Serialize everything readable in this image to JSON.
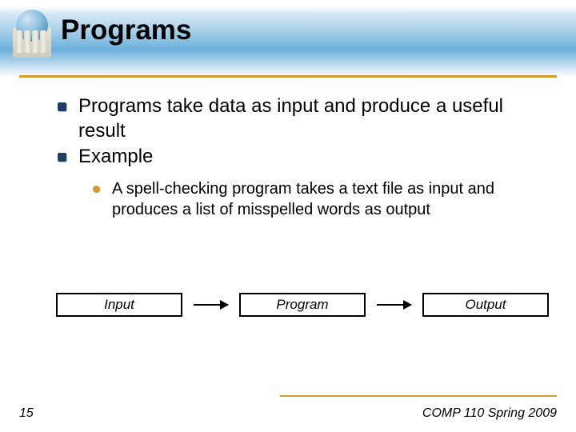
{
  "title": "Programs",
  "bullets": {
    "lvl1": [
      "Programs take data as input and produce a useful result",
      "Example"
    ],
    "lvl2": [
      "A spell-checking program takes a text file as input and produces a list of misspelled words as output"
    ]
  },
  "flow": {
    "input": "Input",
    "program": "Program",
    "output": "Output"
  },
  "footer": {
    "slide_number": "15",
    "course": "COMP 110 Spring 2009"
  }
}
